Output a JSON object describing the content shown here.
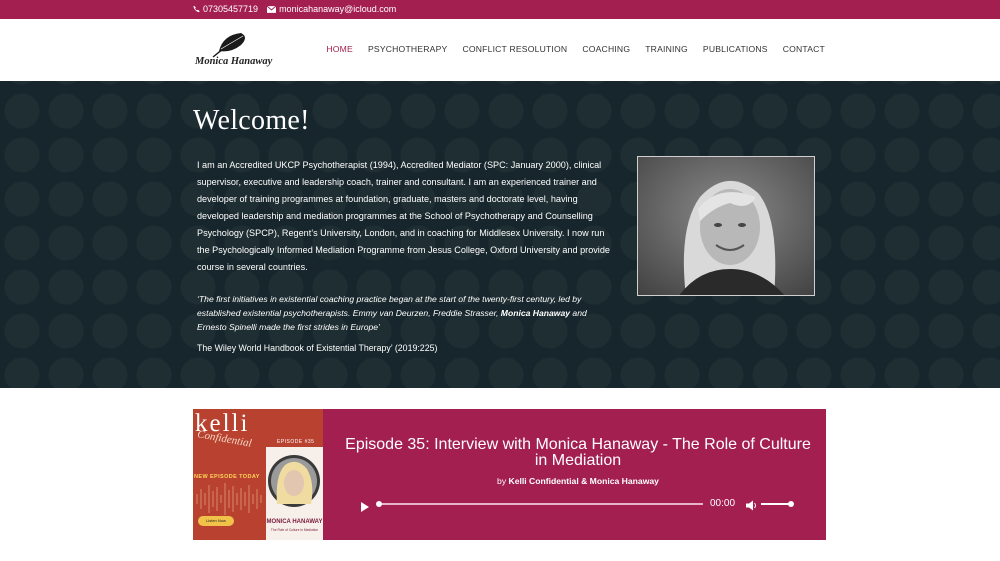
{
  "topbar": {
    "phone": "07305457719",
    "email": "monicahanaway@icloud.com",
    "color": "#a31f50"
  },
  "header": {
    "logo_text": "Monica Hanaway",
    "logo_icon": "leaf-icon",
    "nav": [
      {
        "label": "HOME",
        "active": true
      },
      {
        "label": "PSYCHOTHERAPY",
        "active": false
      },
      {
        "label": "CONFLICT RESOLUTION",
        "active": false
      },
      {
        "label": "COACHING",
        "active": false
      },
      {
        "label": "TRAINING",
        "active": false
      },
      {
        "label": "PUBLICATIONS",
        "active": false
      },
      {
        "label": "CONTACT",
        "active": false
      }
    ]
  },
  "hero": {
    "title": "Welcome!",
    "bio": "I am an  Accredited UKCP Psychotherapist (1994),  Accredited Mediator (SPC: January 2000), clinical supervisor, executive and leadership coach, trainer and consultant. I am an experienced trainer and developer of training programmes at foundation, graduate, masters and doctorate level, having developed leadership and mediation programmes at the School of Psychotherapy and Counselling Psychology (SPCP), Regent’s University, London, and in coaching for Middlesex University.  I now run the Psychologically Informed Mediation Programme from Jesus College, Oxford University and provide course in several countries.",
    "quote_before": "‘The first initiatives in existential coaching practice began at the start of the twenty-first century, led by established existential psychotherapists. Emmy van Deurzen, Freddie Strasser, ",
    "quote_bold": "Monica Hanaway",
    "quote_after": " and Ernesto Spinelli made the first strides in Europe’",
    "citation": "The Wiley World Handbook of Existential Therapy’ (2019:225)",
    "background": "#17262c"
  },
  "podcast": {
    "cover": {
      "title": "kelli",
      "script": "Confidential",
      "episode": "EPISODE #35",
      "new_episode": "NEW EPISODE TODAY",
      "listen": "Listen Now",
      "name": "MONICA HANAWAY",
      "subtitle": "The Role of Culture in Mediation"
    },
    "episode_title": "Episode 35: Interview with Monica Hanaway - The Role of Culture in Mediation",
    "by_prefix": "by ",
    "by_names": "Kelli Confidential & Monica Hanaway",
    "time": "00:00",
    "progress": 0,
    "volume": 1.0
  }
}
